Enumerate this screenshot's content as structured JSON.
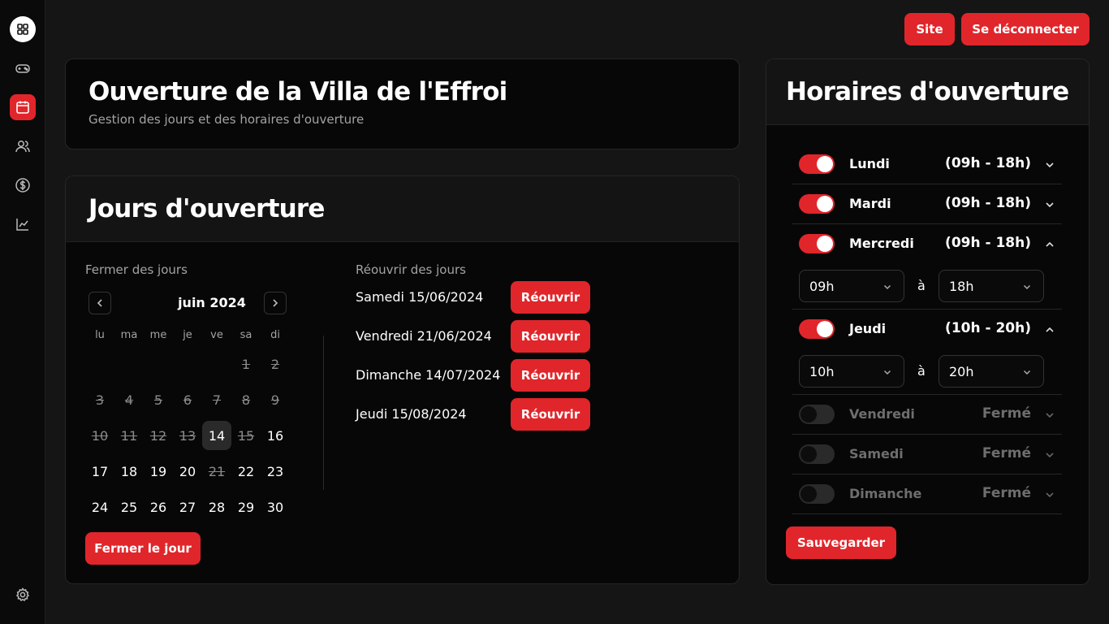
{
  "topbar": {
    "site_label": "Site",
    "logout_label": "Se déconnecter"
  },
  "header": {
    "title": "Ouverture de la Villa de l'Effroi",
    "subtitle": "Gestion des jours et des horaires d'ouverture"
  },
  "days_card": {
    "title": "Jours d'ouverture",
    "close_section_label": "Fermer des jours",
    "reopen_section_label": "Réouvrir des jours",
    "close_button": "Fermer le jour"
  },
  "calendar": {
    "month_label": "juin 2024",
    "weekdays": [
      "lu",
      "ma",
      "me",
      "je",
      "ve",
      "sa",
      "di"
    ],
    "weeks": [
      [
        {
          "d": ""
        },
        {
          "d": ""
        },
        {
          "d": ""
        },
        {
          "d": ""
        },
        {
          "d": ""
        },
        {
          "d": "1",
          "closed": true
        },
        {
          "d": "2",
          "closed": true
        }
      ],
      [
        {
          "d": "3",
          "closed": true
        },
        {
          "d": "4",
          "closed": true
        },
        {
          "d": "5",
          "closed": true
        },
        {
          "d": "6",
          "closed": true
        },
        {
          "d": "7",
          "closed": true
        },
        {
          "d": "8",
          "closed": true
        },
        {
          "d": "9",
          "closed": true
        }
      ],
      [
        {
          "d": "10",
          "closed": true
        },
        {
          "d": "11",
          "closed": true
        },
        {
          "d": "12",
          "closed": true
        },
        {
          "d": "13",
          "closed": true
        },
        {
          "d": "14",
          "today": true
        },
        {
          "d": "15",
          "closed": true
        },
        {
          "d": "16"
        }
      ],
      [
        {
          "d": "17"
        },
        {
          "d": "18"
        },
        {
          "d": "19"
        },
        {
          "d": "20"
        },
        {
          "d": "21",
          "closed": true
        },
        {
          "d": "22"
        },
        {
          "d": "23"
        }
      ],
      [
        {
          "d": "24"
        },
        {
          "d": "25"
        },
        {
          "d": "26"
        },
        {
          "d": "27"
        },
        {
          "d": "28"
        },
        {
          "d": "29"
        },
        {
          "d": "30"
        }
      ]
    ]
  },
  "reopen_list": [
    {
      "date": "Samedi 15/06/2024",
      "button": "Réouvrir"
    },
    {
      "date": "Vendredi 21/06/2024",
      "button": "Réouvrir"
    },
    {
      "date": "Dimanche 14/07/2024",
      "button": "Réouvrir"
    },
    {
      "date": "Jeudi 15/08/2024",
      "button": "Réouvrir"
    }
  ],
  "hours_card": {
    "title": "Horaires d'ouverture",
    "separator": "à",
    "save_button": "Sauvegarder",
    "days": [
      {
        "name": "Lundi",
        "hours": "(09h - 18h)",
        "open": true,
        "expanded": false
      },
      {
        "name": "Mardi",
        "hours": "(09h - 18h)",
        "open": true,
        "expanded": false
      },
      {
        "name": "Mercredi",
        "hours": "(09h - 18h)",
        "open": true,
        "expanded": true,
        "from": "09h",
        "to": "18h"
      },
      {
        "name": "Jeudi",
        "hours": "(10h - 20h)",
        "open": true,
        "expanded": true,
        "from": "10h",
        "to": "20h"
      },
      {
        "name": "Vendredi",
        "hours": "Fermé",
        "open": false,
        "expanded": false
      },
      {
        "name": "Samedi",
        "hours": "Fermé",
        "open": false,
        "expanded": false
      },
      {
        "name": "Dimanche",
        "hours": "Fermé",
        "open": false,
        "expanded": false
      }
    ]
  },
  "colors": {
    "accent": "#e0262b",
    "background": "#151515",
    "card": "#070707"
  },
  "icons": [
    "dashboard-icon",
    "gamepad-icon",
    "calendar-icon",
    "users-icon",
    "dollar-icon",
    "chart-icon",
    "settings-icon"
  ]
}
